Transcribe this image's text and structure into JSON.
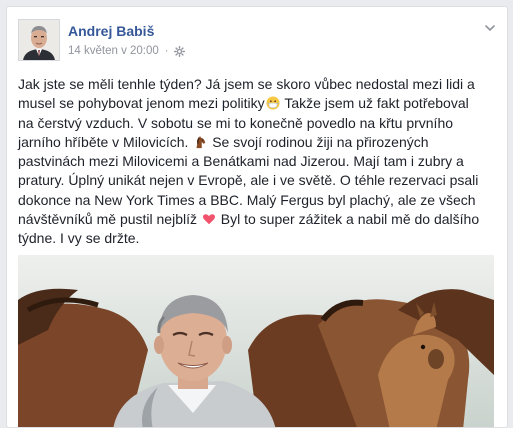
{
  "post": {
    "author": "Andrej Babiš",
    "timestamp": "14 květen v 20:00",
    "separator": "·",
    "privacy_icon": "globe-icon",
    "menu_icon": "chevron-down-icon",
    "text_parts": [
      "Jak jste se měli tenhle týden? Já jsem se skoro vůbec nedostal mezi lidi a musel se pohybovat jenom mezi politiky",
      "Takže jsem už fakt potřeboval na čerstvý vzduch. V sobotu se mi to konečně povedlo na křtu prvního jarního hříběte v Milovicích.",
      "Se svojí rodinou žiji na přirozených pastvinách mezi Milovicemi a Benátkami nad Jizerou. Mají tam i zubry a pratury. Úplný unikát nejen v Evropě, ale i ve světě. O téhle rezervaci psali dokonce na New York Times a BBC. Malý Fergus byl plachý, ale ze všech návštěvníků mě pustil nejblíž",
      "Byl to super zážitek a nabil mě do dalšího týdne. I vy se držte."
    ],
    "emoji_icons": [
      "mask-face-emoji-icon",
      "horse-emoji-icon",
      "heart-emoji-icon"
    ]
  },
  "colors": {
    "author": "#365899",
    "meta": "#90949c",
    "text": "#1d2129",
    "background": "#e9ebee",
    "card": "#ffffff"
  }
}
